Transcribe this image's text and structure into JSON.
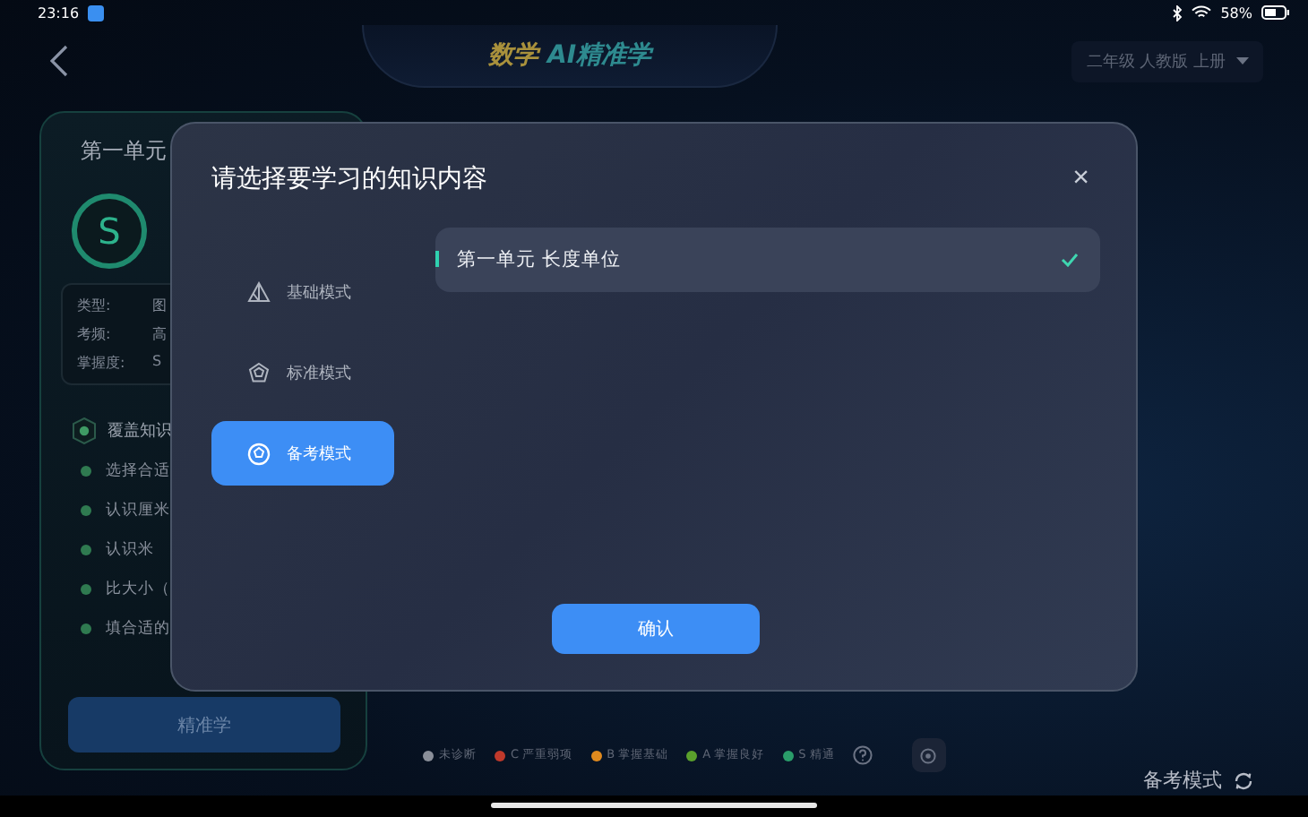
{
  "status_bar": {
    "time": "23:16",
    "battery": "58%"
  },
  "header": {
    "title_main": "数学",
    "title_sub": "AI精准学",
    "grade_selector": "二年级 人教版 上册"
  },
  "unit_card": {
    "title": "第一单元",
    "grade_badge": "S",
    "info": [
      {
        "label": "类型:",
        "value": "图"
      },
      {
        "label": "考频:",
        "value": "高"
      },
      {
        "label": "掌握度:",
        "value": "S"
      }
    ],
    "section_title": "覆盖知识",
    "points": [
      "选择合适",
      "认识厘米",
      "认识米",
      "比大小（",
      "填合适的"
    ],
    "button": "精准学"
  },
  "dialog": {
    "title": "请选择要学习的知识内容",
    "close": "×",
    "modes": [
      {
        "label": "基础模式",
        "selected": false
      },
      {
        "label": "标准模式",
        "selected": false
      },
      {
        "label": "备考模式",
        "selected": true
      }
    ],
    "units": [
      {
        "label": "第一单元 长度单位",
        "selected": true
      }
    ],
    "confirm": "确认"
  },
  "legend": [
    {
      "label": "未诊断",
      "color": "#8a8f99"
    },
    {
      "label": "C 严重弱项",
      "color": "#c0392b"
    },
    {
      "label": "B 掌握基础",
      "color": "#e08a1e"
    },
    {
      "label": "A 掌握良好",
      "color": "#5aa02c"
    },
    {
      "label": "S 精通",
      "color": "#2a9d6a"
    }
  ],
  "mode_indicator": "备考模式"
}
